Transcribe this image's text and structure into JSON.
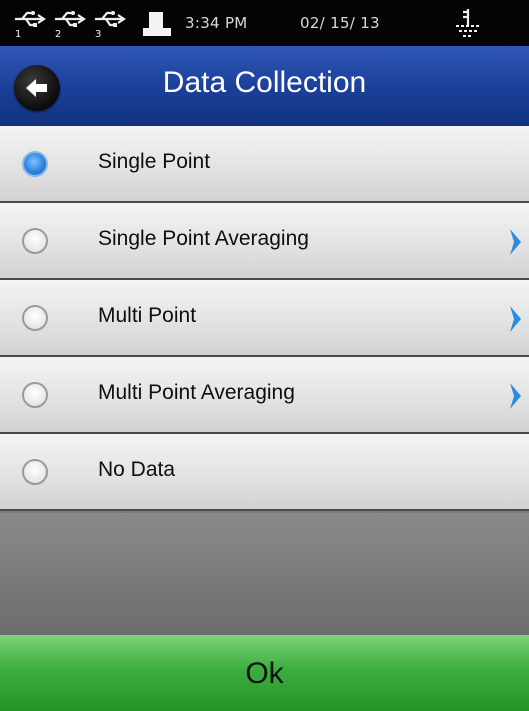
{
  "status_bar": {
    "usb_ports": [
      "1",
      "2",
      "3"
    ],
    "time": "3:34 PM",
    "date": "02/ 15/ 13"
  },
  "header": {
    "title": "Data Collection"
  },
  "options": [
    {
      "label": "Single Point",
      "selected": true,
      "has_submenu": false
    },
    {
      "label": "Single Point Averaging",
      "selected": false,
      "has_submenu": true
    },
    {
      "label": "Multi Point",
      "selected": false,
      "has_submenu": true
    },
    {
      "label": "Multi Point Averaging",
      "selected": false,
      "has_submenu": true
    },
    {
      "label": "No Data",
      "selected": false,
      "has_submenu": false
    }
  ],
  "footer": {
    "ok_label": "Ok"
  },
  "colors": {
    "title_bar": "#1b3f99",
    "selected_radio": "#2b86e0",
    "ok_button": "#3cae3e"
  }
}
